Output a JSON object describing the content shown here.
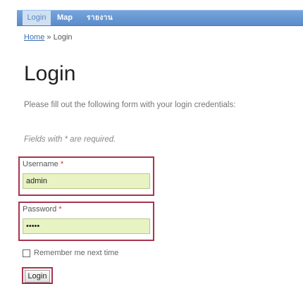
{
  "nav": {
    "items": [
      {
        "label": "Login"
      },
      {
        "label": "Map"
      },
      {
        "label": "รายงาน"
      }
    ]
  },
  "breadcrumb": {
    "home": "Home",
    "separator": "»",
    "current": "Login"
  },
  "main": {
    "title": "Login",
    "instructions": "Please fill out the following form with your login credentials:",
    "required_note": "Fields with * are required."
  },
  "form": {
    "username": {
      "label": "Username",
      "required_mark": "*",
      "value": "admin"
    },
    "password": {
      "label": "Password",
      "required_mark": "*",
      "value": "•••••"
    },
    "remember_label": "Remember me next time",
    "submit_label": "Login"
  },
  "colors": {
    "nav_bar": "#5b8ccb",
    "highlight_border": "#a8344d",
    "input_background": "#e8f3c4",
    "link": "#3a6fb0"
  }
}
